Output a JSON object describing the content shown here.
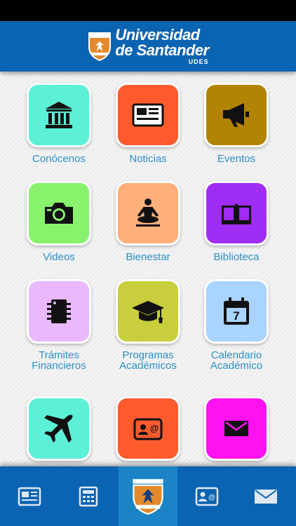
{
  "header": {
    "logo_line1": "Universidad",
    "logo_line2": "de Santander",
    "logo_abbr": "UDES"
  },
  "colors": {
    "header_bg": "#0b64b2",
    "label": "#2a8fc9",
    "nav_active": "#1a84c7"
  },
  "grid": [
    {
      "label": "Conócenos",
      "icon": "bank-icon",
      "color": "#5cf0d7"
    },
    {
      "label": "Noticias",
      "icon": "newspaper-icon",
      "color": "#ff5a2e"
    },
    {
      "label": "Eventos",
      "icon": "megaphone-icon",
      "color": "#b28403"
    },
    {
      "label": "Videos",
      "icon": "camera-icon",
      "color": "#88f26c"
    },
    {
      "label": "Bienestar",
      "icon": "meditation-icon",
      "color": "#ffb07a"
    },
    {
      "label": "Biblioteca",
      "icon": "book-icon",
      "color": "#a02df5"
    },
    {
      "label": "Trámites Financieros",
      "icon": "chip-icon",
      "color": "#e9b8ff"
    },
    {
      "label": "Programas Académicos",
      "icon": "graduation-cap-icon",
      "color": "#c9ce3c"
    },
    {
      "label": "Calendario Académico",
      "icon": "calendar-icon",
      "color": "#a9d4ff"
    },
    {
      "label": "",
      "icon": "airplane-icon",
      "color": "#5cf0d7"
    },
    {
      "label": "",
      "icon": "contact-card-icon",
      "color": "#ff5a2e"
    },
    {
      "label": "",
      "icon": "envelope-icon",
      "color": "#ff12f1"
    }
  ],
  "nav": [
    {
      "icon": "newspaper-icon"
    },
    {
      "icon": "calculator-icon"
    },
    {
      "icon": "udes-crest-icon"
    },
    {
      "icon": "contact-card-icon"
    },
    {
      "icon": "mail-icon"
    }
  ]
}
